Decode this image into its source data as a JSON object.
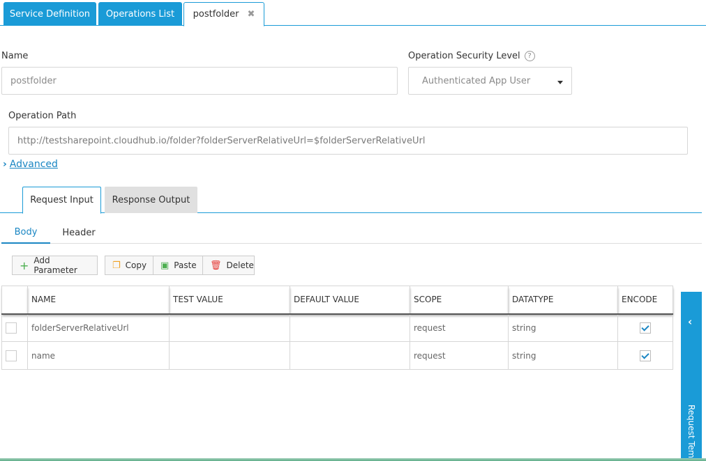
{
  "top_tabs": [
    {
      "label": "Service Definition"
    },
    {
      "label": "Operations List"
    },
    {
      "label": "postfolder",
      "close": "✖"
    }
  ],
  "form": {
    "name_label": "Name",
    "name_value": "postfolder",
    "security_label": "Operation Security Level",
    "security_help": "?",
    "security_value": "Authenticated App User",
    "path_label": "Operation Path",
    "path_value": "http://testsharepoint.cloudhub.io/folder?folderServerRelativeUrl=$folderServerRelativeUrl",
    "advanced_label": "Advanced"
  },
  "io_tabs": [
    {
      "label": "Request Input",
      "active": true
    },
    {
      "label": "Response Output",
      "active": false
    }
  ],
  "sub_tabs": [
    {
      "label": "Body",
      "active": true
    },
    {
      "label": "Header",
      "active": false
    }
  ],
  "toolbar": {
    "add_label": "Add Parameter",
    "copy_label": "Copy",
    "paste_label": "Paste",
    "delete_label": "Delete"
  },
  "table": {
    "columns": [
      "NAME",
      "TEST VALUE",
      "DEFAULT VALUE",
      "SCOPE",
      "DATATYPE",
      "ENCODE"
    ],
    "rows": [
      {
        "name": "folderServerRelativeUrl",
        "test_value": "",
        "default_value": "",
        "scope": "request",
        "datatype": "string",
        "encode": true,
        "selected": false
      },
      {
        "name": "name",
        "test_value": "",
        "default_value": "",
        "scope": "request",
        "datatype": "string",
        "encode": true,
        "selected": false
      }
    ]
  },
  "side_panel": {
    "label": "Request Temp"
  },
  "colors": {
    "accent": "#1a9bd7",
    "link": "#1a86c3"
  }
}
